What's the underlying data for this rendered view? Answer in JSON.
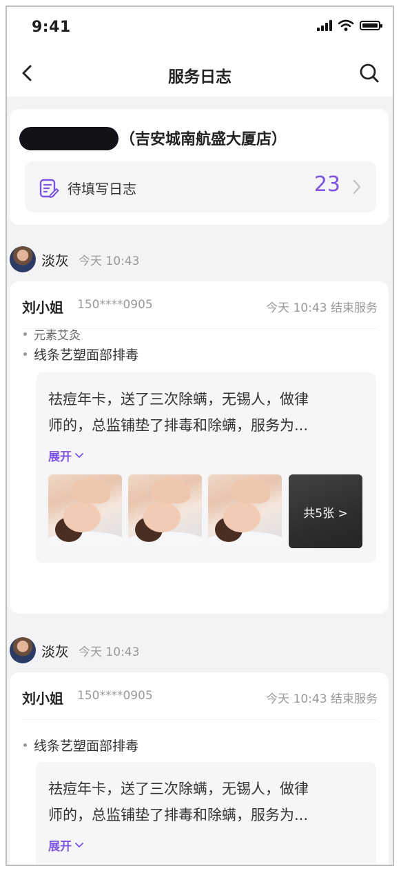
{
  "status_bar": {
    "time": "9:41"
  },
  "nav": {
    "title": "服务日志"
  },
  "store": {
    "name_suffix": "（吉安城南航盛大厦店）",
    "pending_label": "待填写日志",
    "pending_count": "23"
  },
  "logs": [
    {
      "author": "淡灰",
      "author_time": "今天 10:43",
      "customer_name": "刘小姐",
      "customer_phone": "150****0905",
      "status": "今天 10:43 结束服务",
      "services": [
        "元素艾灸",
        "线条艺塑面部排毒"
      ],
      "note_line1": "祛痘年卡，送了三次除螨，无锡人，做律",
      "note_line2": "师的，总监铺垫了排毒和除螨，服务为...",
      "expand_label": "展开",
      "photos_more_label": "共5张 >"
    },
    {
      "author": "淡灰",
      "author_time": "今天 10:43",
      "customer_name": "刘小姐",
      "customer_phone": "150****0905",
      "status": "今天 10:43 结束服务",
      "services": [
        "线条艺塑面部排毒"
      ],
      "note_line1": "祛痘年卡，送了三次除螨，无锡人，做律",
      "note_line2": "师的，总监铺垫了排毒和除螨，服务为...",
      "expand_label": "展开"
    }
  ],
  "colors": {
    "accent": "#7c54e0",
    "muted": "#999999",
    "background": "#f3f3f6"
  },
  "icons": {
    "back": "chevron-left-icon",
    "search": "search-icon",
    "pending": "edit-note-icon",
    "chevron": "chevron-right-icon",
    "expand": "chevron-down-icon"
  }
}
